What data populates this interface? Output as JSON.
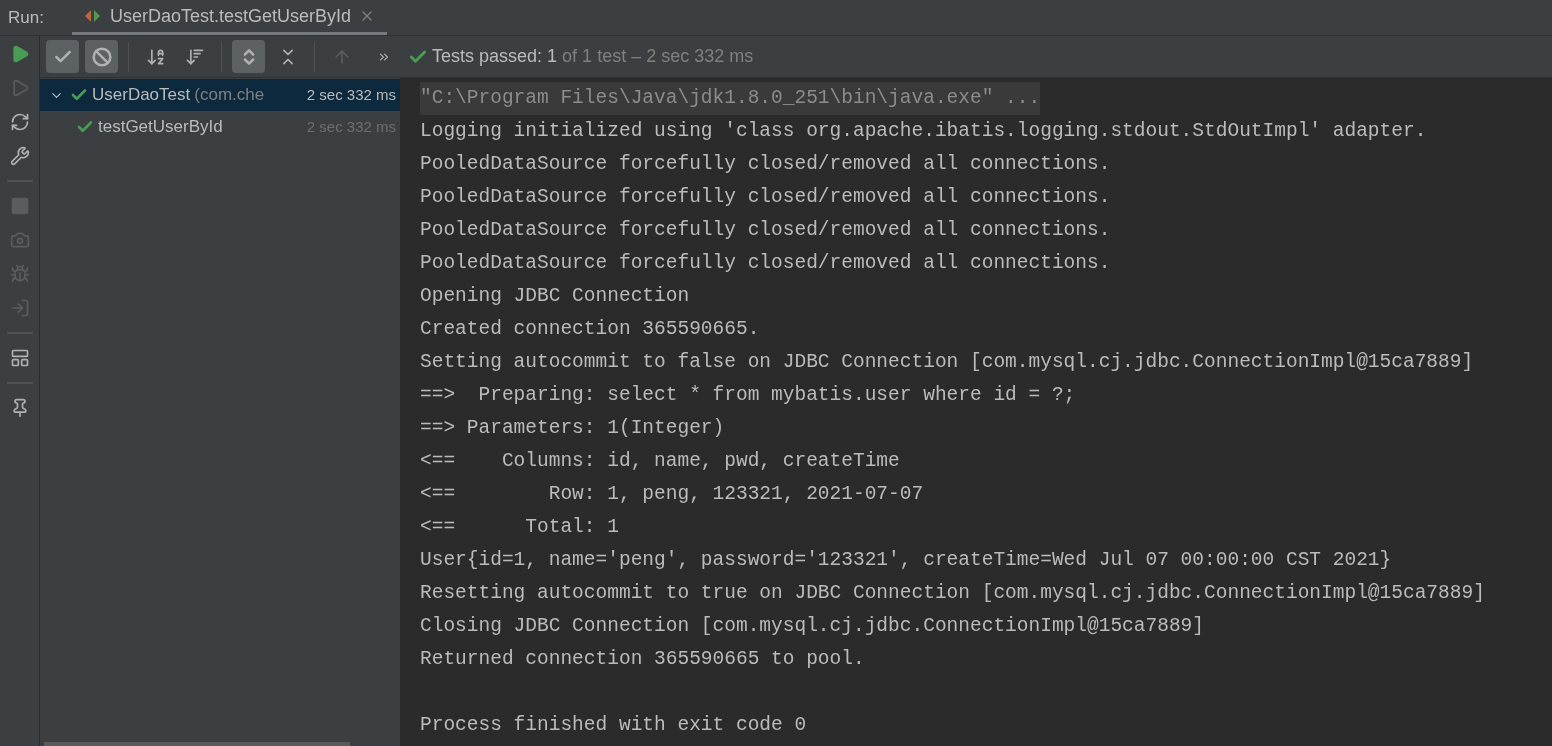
{
  "run_label": "Run:",
  "tab": {
    "title": "UserDaoTest.testGetUserById",
    "selected": true
  },
  "side_tools": [
    {
      "kind": "rerun",
      "disabled": false
    },
    {
      "kind": "rerun-failed",
      "disabled": true
    },
    {
      "kind": "auto-test",
      "disabled": false
    },
    {
      "kind": "wrench",
      "disabled": false
    },
    {
      "kind": "separator"
    },
    {
      "kind": "stop",
      "disabled": true
    },
    {
      "kind": "camera",
      "disabled": true
    },
    {
      "kind": "bug",
      "disabled": true
    },
    {
      "kind": "import",
      "disabled": true
    },
    {
      "kind": "separator"
    },
    {
      "kind": "layout",
      "disabled": false
    },
    {
      "kind": "separator"
    },
    {
      "kind": "pin",
      "disabled": false
    }
  ],
  "toolbar": [
    {
      "kind": "show-passed",
      "on": true
    },
    {
      "kind": "show-ignored",
      "on": true
    },
    {
      "kind": "separator"
    },
    {
      "kind": "sort-alpha",
      "on": false
    },
    {
      "kind": "sort-duration",
      "on": false
    },
    {
      "kind": "separator"
    },
    {
      "kind": "expand-all",
      "on": true
    },
    {
      "kind": "collapse-all",
      "on": false
    },
    {
      "kind": "separator"
    },
    {
      "kind": "previous",
      "on": false
    },
    {
      "kind": "more",
      "on": false
    }
  ],
  "status": {
    "passed": true,
    "label": "Tests passed:",
    "count": "1",
    "detail": "of 1 test – 2 sec 332 ms"
  },
  "tree": [
    {
      "name": "UserDaoTest",
      "suffix": "(com.che",
      "time": "2 sec 332 ms",
      "passed": true,
      "selected": true,
      "expanded": true,
      "children": [
        {
          "name": "testGetUserById",
          "time": "2 sec 332 ms",
          "passed": true,
          "selected": false
        }
      ]
    }
  ],
  "console": [
    {
      "kind": "command",
      "text": "\"C:\\Program Files\\Java\\jdk1.8.0_251\\bin\\java.exe\" ..."
    },
    {
      "kind": "output",
      "text": "Logging initialized using 'class org.apache.ibatis.logging.stdout.StdOutImpl' adapter."
    },
    {
      "kind": "output",
      "text": "PooledDataSource forcefully closed/removed all connections."
    },
    {
      "kind": "output",
      "text": "PooledDataSource forcefully closed/removed all connections."
    },
    {
      "kind": "output",
      "text": "PooledDataSource forcefully closed/removed all connections."
    },
    {
      "kind": "output",
      "text": "PooledDataSource forcefully closed/removed all connections."
    },
    {
      "kind": "output",
      "text": "Opening JDBC Connection"
    },
    {
      "kind": "output",
      "text": "Created connection 365590665."
    },
    {
      "kind": "output",
      "text": "Setting autocommit to false on JDBC Connection [com.mysql.cj.jdbc.ConnectionImpl@15ca7889]"
    },
    {
      "kind": "output",
      "text": "==>  Preparing: select * from mybatis.user where id = ?;"
    },
    {
      "kind": "output",
      "text": "==> Parameters: 1(Integer)"
    },
    {
      "kind": "output",
      "text": "<==    Columns: id, name, pwd, createTime"
    },
    {
      "kind": "output",
      "text": "<==        Row: 1, peng, 123321, 2021-07-07"
    },
    {
      "kind": "output",
      "text": "<==      Total: 1"
    },
    {
      "kind": "output",
      "text": "User{id=1, name='peng', password='123321', createTime=Wed Jul 07 00:00:00 CST 2021}"
    },
    {
      "kind": "output",
      "text": "Resetting autocommit to true on JDBC Connection [com.mysql.cj.jdbc.ConnectionImpl@15ca7889]"
    },
    {
      "kind": "output",
      "text": "Closing JDBC Connection [com.mysql.cj.jdbc.ConnectionImpl@15ca7889]"
    },
    {
      "kind": "output",
      "text": "Returned connection 365590665 to pool."
    },
    {
      "kind": "exit",
      "text": "Process finished with exit code 0"
    }
  ]
}
